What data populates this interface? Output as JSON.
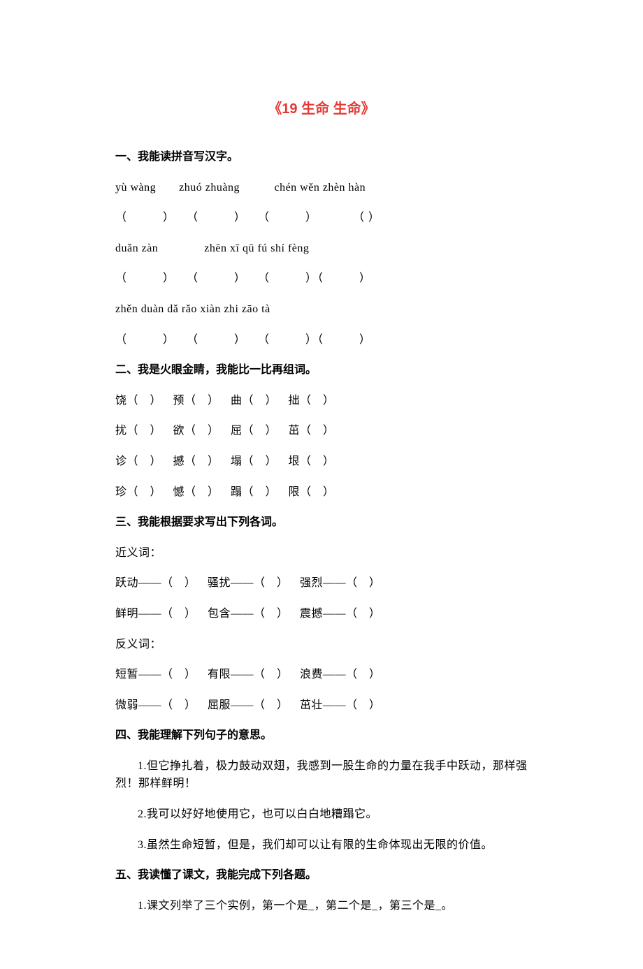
{
  "title": "《19 生命 生命》",
  "section1": {
    "header": "一、我能读拼音写汉字。",
    "pinyin1": "yù wàng  zhuó zhuàng   chén wěn zhèn hàn",
    "blanks1": "（   ） （   ） （   ）   （ ）",
    "pinyin2": "duǎn zàn    zhēn xī qū fú shí fèng",
    "blanks2": "（   ） （   ） （   ）（   ）",
    "pinyin3": "zhěn duàn dǎ rǎo xiàn zhi zāo tà",
    "blanks3": "（   ） （   ） （   ）（   ）"
  },
  "section2": {
    "header": "二、我是火眼金睛，我能比一比再组词。",
    "line1": "饶（ ） 预（ ） 曲（ ） 拙（ ）",
    "line2": "扰（ ） 欲（ ） 屈（ ） 茁（ ）",
    "line3": "诊（ ） 撼（ ） 塌（ ） 垠（ ）",
    "line4": "珍（ ） 憾（ ） 蹋（ ） 限（ ）"
  },
  "section3": {
    "header": "三、我能根据要求写出下列各词。",
    "label1": "近义词：",
    "line1": "跃动——（ ） 骚扰——（ ） 强烈——（ ）",
    "line2": "鲜明——（ ） 包含——（ ） 震撼——（ ）",
    "label2": "反义词：",
    "line3": "短暂——（ ） 有限——（ ） 浪费——（ ）",
    "line4": "微弱——（ ） 屈服——（ ） 茁壮——（ ）"
  },
  "section4": {
    "header": "四、我能理解下列句子的意思。",
    "q1": "1.但它挣扎着，极力鼓动双翅，我感到一股生命的力量在我手中跃动，那样强烈！那样鲜明！",
    "q2": "2.我可以好好地使用它，也可以白白地糟蹋它。",
    "q3": "3.虽然生命短暂，但是，我们却可以让有限的生命体现出无限的价值。"
  },
  "section5": {
    "header": "五、我读懂了课文，我能完成下列各题。",
    "q1": "1.课文列举了三个实例，第一个是_，第二个是_，第三个是_。"
  }
}
